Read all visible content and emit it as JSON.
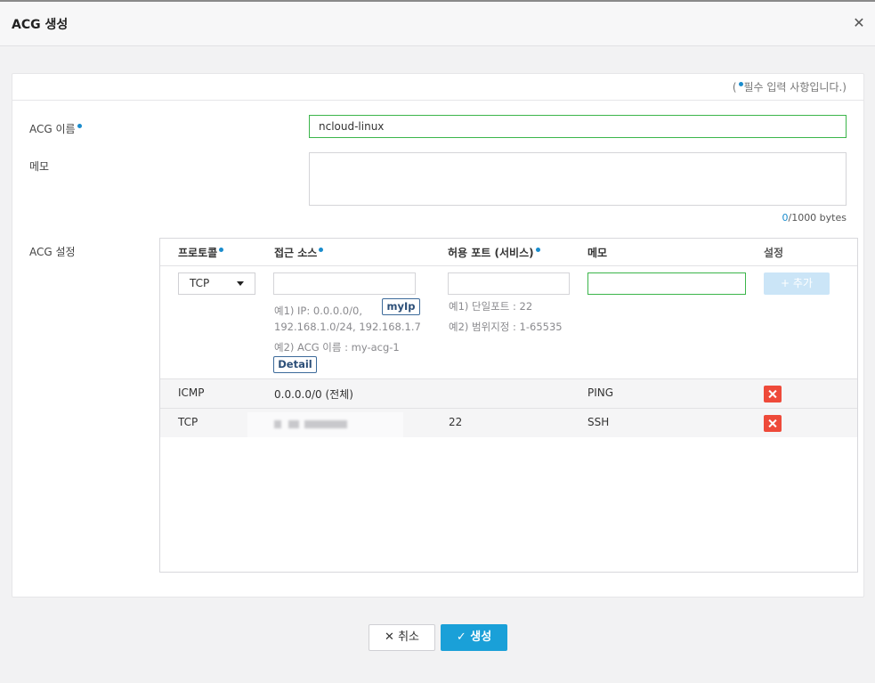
{
  "dialog": {
    "title": "ACG 생성"
  },
  "required_note": {
    "open": "(",
    "text": "필수 입력 사항입니다.)"
  },
  "form": {
    "name_label": "ACG 이름",
    "name_value": "ncloud-linux",
    "memo_label": "메모",
    "memo_value": "",
    "memo_count": "0",
    "memo_max": "/1000 bytes",
    "acg_settings_label": "ACG 설정"
  },
  "rules": {
    "columns": {
      "protocol": "프로토콜",
      "source": "접근 소스",
      "port": "허용 포트 (서비스)",
      "memo": "메모",
      "settings": "설정"
    },
    "new_rule": {
      "protocol_selected": "TCP",
      "source_value": "",
      "port_value": "",
      "memo_value": "",
      "myip_label": "myIp",
      "detail_label": "Detail",
      "add_label": "+ 추가",
      "source_hint_1a": "예1) IP: 0.0.0.0/0,",
      "source_hint_1b": "192.168.1.0/24, 192.168.1.7",
      "source_hint_2": "예2) ACG 이름 : my-acg-1",
      "port_hint_1": "예1) 단일포트 : 22",
      "port_hint_2": "예2) 범위지정 : 1-65535"
    },
    "rows": [
      {
        "protocol": "ICMP",
        "source": "0.0.0.0/0 (전체)",
        "port": "",
        "memo": "PING"
      },
      {
        "protocol": "TCP",
        "source": "",
        "port": "22",
        "memo": "SSH"
      }
    ]
  },
  "footer": {
    "cancel_label": "취소",
    "create_label": "생성"
  },
  "icons": {
    "close": "close-icon",
    "required": "required-dot-icon",
    "dropdown": "caret-down-icon",
    "delete": "delete-icon",
    "cancel": "x-icon",
    "confirm": "check-icon"
  },
  "colors": {
    "accent": "#1aa0d8",
    "required_dot": "#1a8ccd",
    "valid_border": "#3bb54a",
    "delete": "#ee4a3a",
    "add_disabled": "#cbe5f7"
  }
}
